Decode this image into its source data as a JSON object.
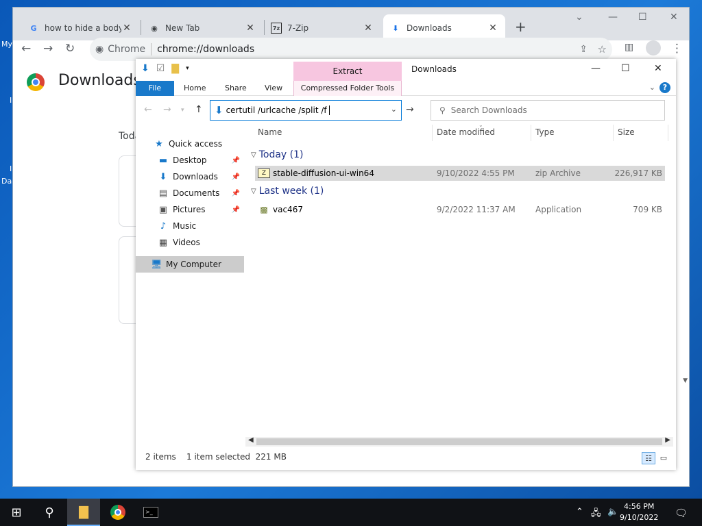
{
  "desktop": {
    "frag1": "My",
    "frag2": "I",
    "frag3": "I",
    "frag4": "Da"
  },
  "browser": {
    "tabs": [
      {
        "label": "how to hide a body fi",
        "icon": "G"
      },
      {
        "label": "New Tab",
        "icon": "chrome"
      },
      {
        "label": "7-Zip",
        "icon": "7z"
      },
      {
        "label": "Downloads",
        "icon": "download"
      }
    ],
    "site_name": "Chrome",
    "url": "chrome://downloads",
    "page_title": "Downloads",
    "today_label": "Toda"
  },
  "explorer": {
    "context_tab": "Extract",
    "caption": "Downloads",
    "ribbon_tabs": [
      "File",
      "Home",
      "Share",
      "View"
    ],
    "context_group": "Compressed Folder Tools",
    "address_value": "certutil /urlcache /split /f",
    "search_placeholder": "Search Downloads",
    "nav_items": [
      {
        "label": "Quick access",
        "icon": "star-icon",
        "pinned": false
      },
      {
        "label": "Desktop",
        "icon": "desktop-icon",
        "pinned": true
      },
      {
        "label": "Downloads",
        "icon": "downloads-icon",
        "pinned": true
      },
      {
        "label": "Documents",
        "icon": "documents-icon",
        "pinned": true
      },
      {
        "label": "Pictures",
        "icon": "pictures-icon",
        "pinned": true
      },
      {
        "label": "Music",
        "icon": "music-icon",
        "pinned": false
      },
      {
        "label": "Videos",
        "icon": "videos-icon",
        "pinned": false
      },
      {
        "label": "My Computer",
        "icon": "computer-icon",
        "pinned": false
      }
    ],
    "columns": [
      "Name",
      "Date modified",
      "Type",
      "Size"
    ],
    "groups": [
      {
        "label": "Today (1)",
        "files": [
          {
            "name": "stable-diffusion-ui-win64",
            "date": "9/10/2022 4:55 PM",
            "type": "zip Archive",
            "size": "226,917 KB",
            "selected": true
          }
        ]
      },
      {
        "label": "Last week (1)",
        "files": [
          {
            "name": "vac467",
            "date": "9/2/2022 11:37 AM",
            "type": "Application",
            "size": "709 KB",
            "selected": false
          }
        ]
      }
    ],
    "status": {
      "count": "2 items",
      "selection": "1 item selected  221 MB"
    }
  },
  "taskbar": {
    "time": "4:56 PM",
    "date": "9/10/2022"
  },
  "colors": {
    "accent": "#1979ca",
    "context_tab": "#f7c6e0",
    "taskbar": "#101216"
  }
}
